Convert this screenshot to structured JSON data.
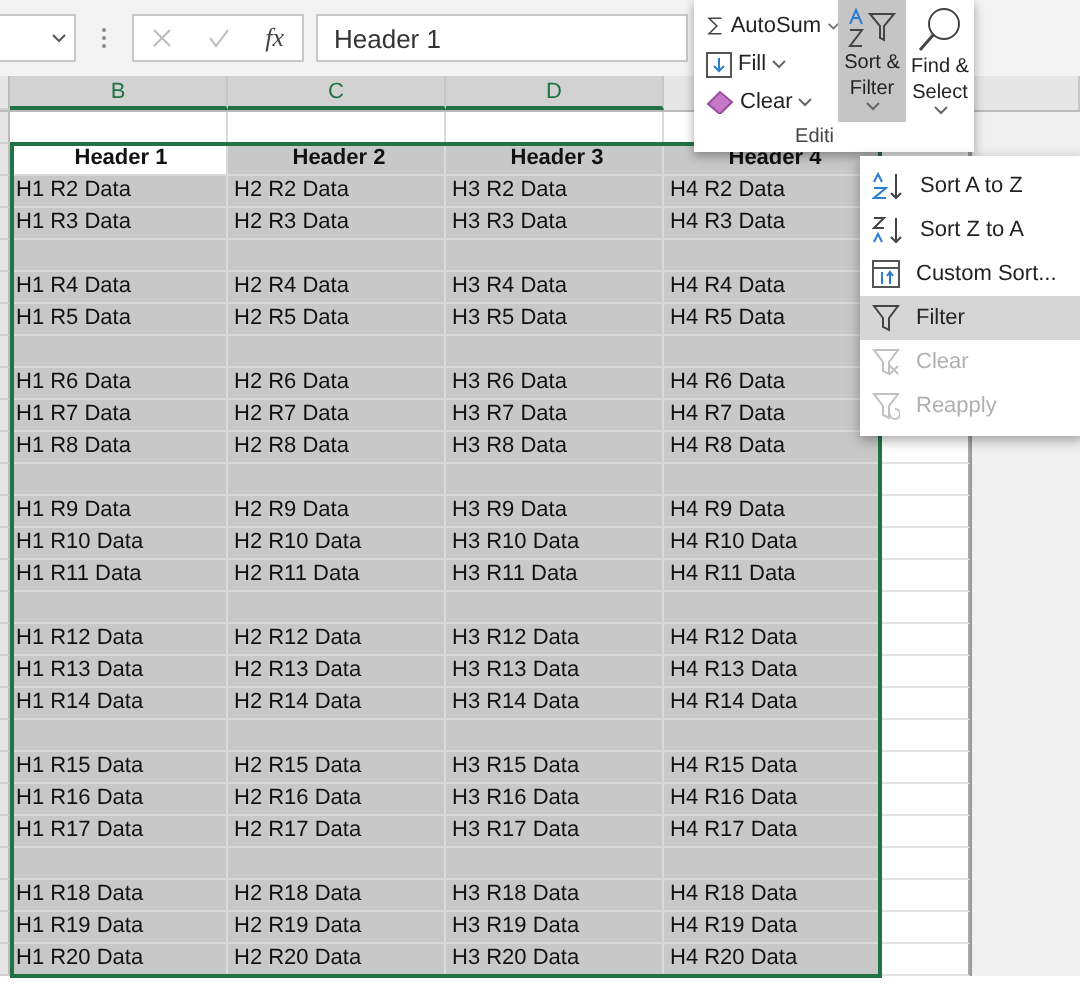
{
  "formula_bar": {
    "fx_label": "fx",
    "value": "Header 1"
  },
  "column_headers": [
    {
      "label": "B",
      "selected": true
    },
    {
      "label": "C",
      "selected": true
    },
    {
      "label": "D",
      "selected": true
    }
  ],
  "table": {
    "rows": [
      {
        "kind": "header",
        "cells": [
          {
            "text": "Header 1",
            "active": true
          },
          {
            "text": "Header 2",
            "active": false
          },
          {
            "text": "Header 3",
            "active": false
          },
          {
            "text": "Header 4",
            "active": false
          }
        ]
      },
      {
        "kind": "data",
        "cells": [
          "H1 R2 Data",
          "H2 R2 Data",
          "H3 R2 Data",
          "H4 R2 Data"
        ]
      },
      {
        "kind": "data",
        "cells": [
          "H1 R3 Data",
          "H2 R3 Data",
          "H3 R3 Data",
          "H4 R3 Data"
        ]
      },
      {
        "kind": "blank"
      },
      {
        "kind": "data",
        "cells": [
          "H1 R4 Data",
          "H2 R4 Data",
          "H3 R4 Data",
          "H4 R4 Data"
        ]
      },
      {
        "kind": "data",
        "cells": [
          "H1 R5 Data",
          "H2 R5 Data",
          "H3 R5 Data",
          "H4 R5 Data"
        ]
      },
      {
        "kind": "blank"
      },
      {
        "kind": "data",
        "cells": [
          "H1 R6 Data",
          "H2 R6 Data",
          "H3 R6 Data",
          "H4 R6 Data"
        ]
      },
      {
        "kind": "data",
        "cells": [
          "H1 R7 Data",
          "H2 R7 Data",
          "H3 R7 Data",
          "H4 R7 Data"
        ]
      },
      {
        "kind": "data",
        "cells": [
          "H1 R8 Data",
          "H2 R8 Data",
          "H3 R8 Data",
          "H4 R8 Data"
        ]
      },
      {
        "kind": "blank"
      },
      {
        "kind": "data",
        "cells": [
          "H1 R9 Data",
          "H2 R9 Data",
          "H3 R9 Data",
          "H4 R9 Data"
        ]
      },
      {
        "kind": "data",
        "cells": [
          "H1 R10 Data",
          "H2 R10 Data",
          "H3 R10 Data",
          "H4 R10 Data"
        ]
      },
      {
        "kind": "data",
        "cells": [
          "H1 R11 Data",
          "H2 R11 Data",
          "H3 R11 Data",
          "H4 R11 Data"
        ]
      },
      {
        "kind": "blank"
      },
      {
        "kind": "data",
        "cells": [
          "H1 R12 Data",
          "H2 R12 Data",
          "H3 R12 Data",
          "H4 R12 Data"
        ]
      },
      {
        "kind": "data",
        "cells": [
          "H1 R13 Data",
          "H2 R13 Data",
          "H3 R13 Data",
          "H4 R13 Data"
        ]
      },
      {
        "kind": "data",
        "cells": [
          "H1 R14 Data",
          "H2 R14 Data",
          "H3 R14 Data",
          "H4 R14 Data"
        ]
      },
      {
        "kind": "blank"
      },
      {
        "kind": "data",
        "cells": [
          "H1 R15 Data",
          "H2 R15 Data",
          "H3 R15 Data",
          "H4 R15 Data"
        ]
      },
      {
        "kind": "data",
        "cells": [
          "H1 R16 Data",
          "H2 R16 Data",
          "H3 R16 Data",
          "H4 R16 Data"
        ]
      },
      {
        "kind": "data",
        "cells": [
          "H1 R17 Data",
          "H2 R17 Data",
          "H3 R17 Data",
          "H4 R17 Data"
        ]
      },
      {
        "kind": "blank"
      },
      {
        "kind": "data",
        "cells": [
          "H1 R18 Data",
          "H2 R18 Data",
          "H3 R18 Data",
          "H4 R18 Data"
        ]
      },
      {
        "kind": "data",
        "cells": [
          "H1 R19 Data",
          "H2 R19 Data",
          "H3 R19 Data",
          "H4 R19 Data"
        ]
      },
      {
        "kind": "data",
        "cells": [
          "H1 R20 Data",
          "H2 R20 Data",
          "H3 R20 Data",
          "H4 R20 Data"
        ]
      }
    ]
  },
  "editing_group": {
    "label": "Editi",
    "commands": [
      {
        "kind": "autosum",
        "label": "AutoSum"
      },
      {
        "kind": "fill",
        "label": "Fill"
      },
      {
        "kind": "clear",
        "label": "Clear"
      }
    ],
    "large_buttons": [
      {
        "kind": "sort",
        "lines": [
          "Sort &",
          "Filter"
        ],
        "selected": true
      },
      {
        "kind": "find",
        "lines": [
          "Find &",
          "Select"
        ],
        "selected": false
      }
    ]
  },
  "sort_filter_menu": [
    {
      "kind": "sort-az",
      "label": "Sort A to Z",
      "selected": false,
      "disabled": false
    },
    {
      "kind": "sort-za",
      "label": "Sort Z to A",
      "selected": false,
      "disabled": false
    },
    {
      "kind": "custom",
      "label": "Custom Sort...",
      "selected": false,
      "disabled": false
    },
    {
      "kind": "filter",
      "label": "Filter",
      "selected": true,
      "disabled": false
    },
    {
      "kind": "clear",
      "label": "Clear",
      "selected": false,
      "disabled": true
    },
    {
      "kind": "reapply",
      "label": "Reapply",
      "selected": false,
      "disabled": true
    }
  ]
}
